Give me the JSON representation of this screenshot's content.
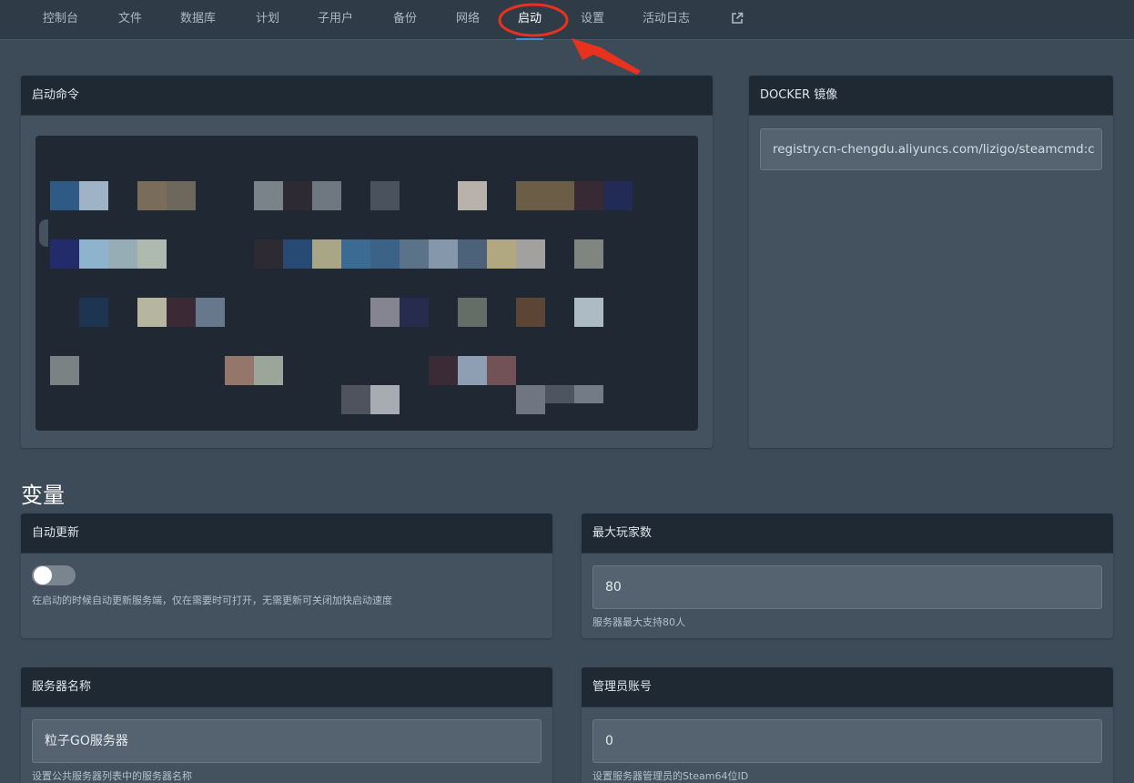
{
  "nav": {
    "items": [
      {
        "label": "控制台"
      },
      {
        "label": "文件"
      },
      {
        "label": "数据库"
      },
      {
        "label": "计划"
      },
      {
        "label": "子用户"
      },
      {
        "label": "备份"
      },
      {
        "label": "网络"
      },
      {
        "label": "启动"
      },
      {
        "label": "设置"
      },
      {
        "label": "活动日志"
      }
    ],
    "active": "启动",
    "external_icon": "external-link-icon"
  },
  "startup": {
    "title": "启动命令",
    "content_state": "pixelated"
  },
  "docker": {
    "title": "DOCKER 镜像",
    "value": "registry.cn-chengdu.aliyuncs.com/lizigo/steamcmd:c"
  },
  "variables": {
    "title": "变量",
    "auto_update": {
      "title": "自动更新",
      "enabled": false,
      "help": "在启动的时候自动更新服务端，仅在需要时可打开，无需更新可关闭加快启动速度"
    },
    "max_players": {
      "title": "最大玩家数",
      "value": "80",
      "help": "服务器最大支持80人"
    },
    "server_name": {
      "title": "服务器名称",
      "value": "粒子GO服务器",
      "help": "设置公共服务器列表中的服务器名称"
    },
    "admin_account": {
      "title": "管理员账号",
      "value": "0",
      "help": "设置服务器管理员的Steam64位ID"
    }
  },
  "colors": {
    "background": "#3d4a57",
    "panel": "#44525f",
    "panel_header": "#1f2933",
    "accent": "#3d8fd6",
    "annotation": "#e8321e"
  }
}
